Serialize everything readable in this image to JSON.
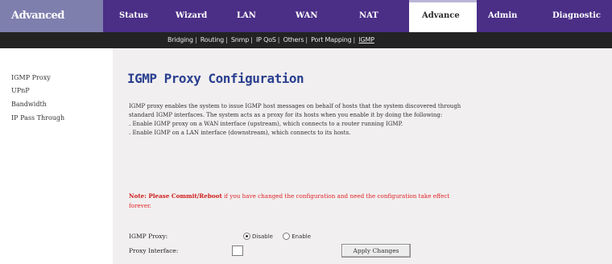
{
  "brand": "Advanced",
  "tabs": [
    {
      "label": "Status"
    },
    {
      "label": "Wizard"
    },
    {
      "label": "LAN"
    },
    {
      "label": "WAN"
    },
    {
      "label": "NAT"
    },
    {
      "label": "Advance"
    },
    {
      "label": "Admin"
    },
    {
      "label": "Diagnostic"
    }
  ],
  "subnav": [
    {
      "label": "Bridging"
    },
    {
      "label": "Routing"
    },
    {
      "label": "Snmp"
    },
    {
      "label": "IP QoS"
    },
    {
      "label": "Others"
    },
    {
      "label": "Port Mapping"
    },
    {
      "label": "IGMP"
    }
  ],
  "sidebar": {
    "items": [
      {
        "label": "IGMP Proxy"
      },
      {
        "label": "UPnP"
      },
      {
        "label": "Bandwidth"
      },
      {
        "label": "IP Pass Through"
      }
    ]
  },
  "main": {
    "title": "IGMP Proxy Configuration",
    "description": [
      "IGMP proxy enables the system to issue IGMP host messages on behalf of hosts that the system discovered through standard IGMP interfaces. The system acts as a proxy for its hosts when you enable it by doing the following:",
      ". Enable IGMP proxy on a WAN interface (upstream), which connects to a router running IGMP.",
      ". Enable IGMP on a LAN interface (downstream), which connects to its hosts."
    ],
    "note_lead": "Note: Please Commit/Reboot",
    "note_rest": " if you have changed the configuration and need the configuration take effect forever.",
    "igmp_proxy_label": "IGMP Proxy:",
    "radio_disable": "Disable",
    "radio_enable": "Enable",
    "proxy_interface_label": "Proxy Interface:",
    "proxy_interface_value": "",
    "apply_button": "Apply Changes"
  }
}
